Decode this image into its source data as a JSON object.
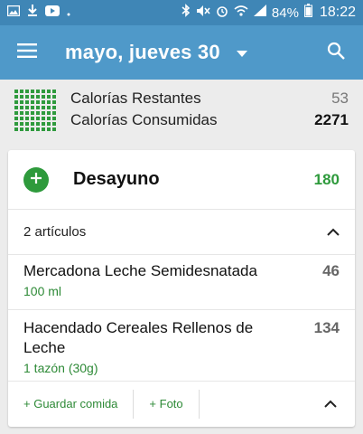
{
  "status_bar": {
    "left_icons": [
      "image-icon",
      "download-icon",
      "youtube-icon"
    ],
    "battery_percent": "84%",
    "time": "18:22"
  },
  "app_bar": {
    "date_title": "mayo, jueves 30"
  },
  "summary": {
    "remaining_label": "Calorías Restantes",
    "remaining_value": "53",
    "consumed_label": "Calorías Consumidas",
    "consumed_value": "2271"
  },
  "meal": {
    "title": "Desayuno",
    "total": "180",
    "items_count": "2 artículos",
    "items": [
      {
        "name": "Mercadona Leche Semidesnatada",
        "serving": "100 ml",
        "calories": "46"
      },
      {
        "name": "Hacendado Cereales Rellenos de Leche",
        "serving": "1 tazón (30g)",
        "calories": "134"
      }
    ],
    "save_label": "+ Guardar comida",
    "photo_label": "+ Foto"
  },
  "colors": {
    "status_bar": "#3f86b6",
    "app_bar": "#4f99c9",
    "accent_green": "#2e9a3c"
  }
}
